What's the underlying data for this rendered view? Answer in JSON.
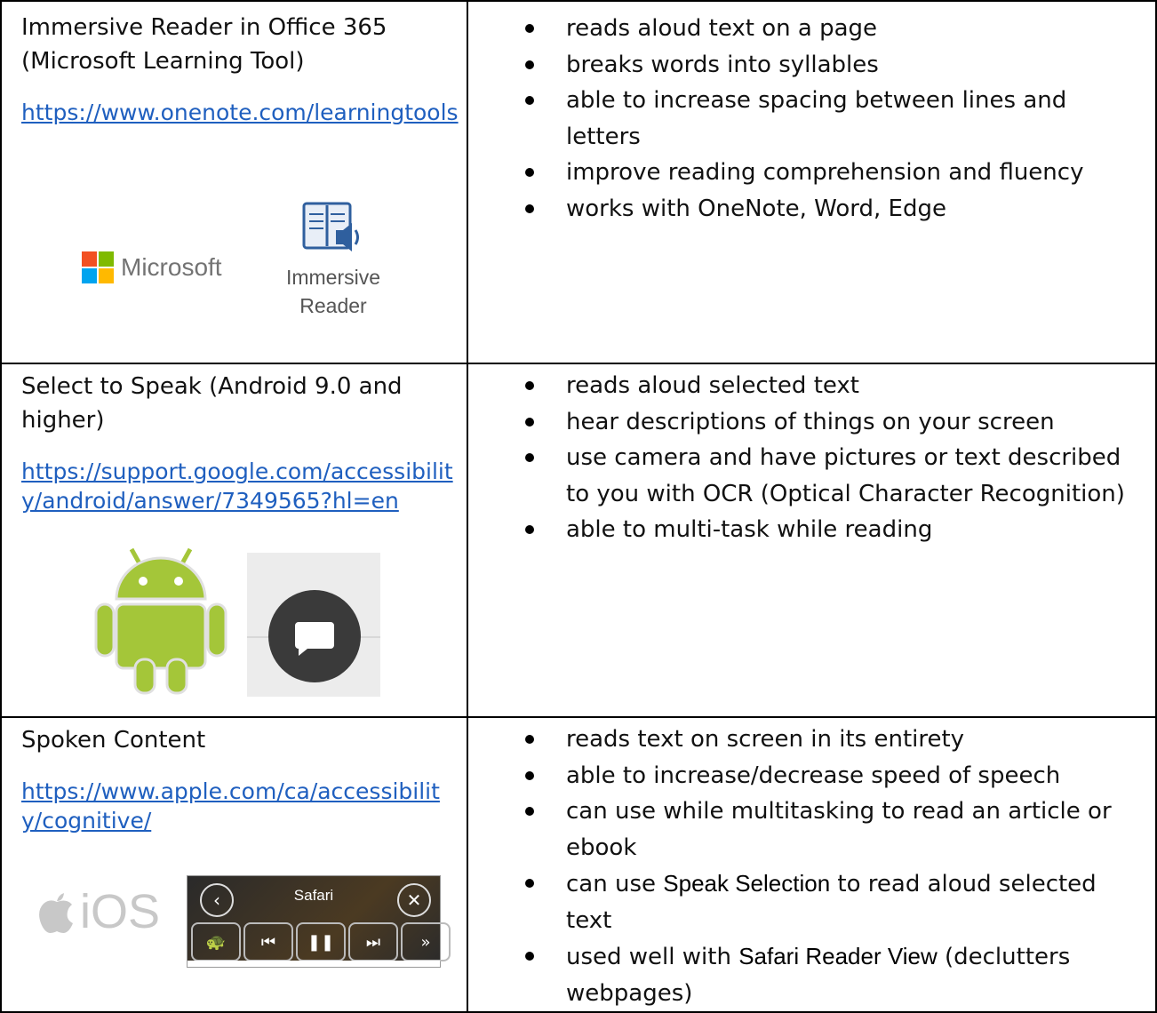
{
  "rows": [
    {
      "title": "Immersive Reader in Office 365 (Microsoft Learning Tool)",
      "link": "https://www.onenote.com/learningtools",
      "logos": {
        "ms_word": "Microsoft",
        "ir_label_1": "Immersive",
        "ir_label_2": "Reader"
      },
      "bullets": [
        "reads aloud text on a page",
        "breaks words into syllables",
        "able to increase spacing between lines and letters",
        "improve reading comprehension and fluency",
        "works with OneNote, Word, Edge"
      ]
    },
    {
      "title": "Select to Speak (Android 9.0 and higher)",
      "link": "https://support.google.com/accessibility/android/answer/7349565?hl=en",
      "bullets": [
        "reads aloud selected text",
        "hear descriptions of things on your screen",
        "use camera and have pictures or text described to you with OCR (Optical Character Recognition)",
        "able to multi-task while reading"
      ]
    },
    {
      "title": "Spoken Content",
      "link": "https://www.apple.com/ca/accessibility/cognitive/",
      "logos": {
        "ios_word": "iOS",
        "safari_title": "Safari"
      },
      "bullets": [
        "reads text on screen in its entirety",
        "able to increase/decrease speed of speech",
        "can use while multitasking to read an article or ebook"
      ],
      "bullet4": {
        "pre": "can use ",
        "bold": "Speak Selection",
        "post": " to read aloud selected text"
      },
      "bullet5": {
        "pre": "used well with ",
        "bold": "Safari Reader View",
        "post": " (declutters webpages)"
      }
    }
  ],
  "colors": {
    "link": "#1f5fbf",
    "android_green": "#a4c639",
    "ms_red": "#f25022",
    "ms_green": "#7fba00",
    "ms_blue": "#00a4ef",
    "ms_yellow": "#ffb900"
  }
}
